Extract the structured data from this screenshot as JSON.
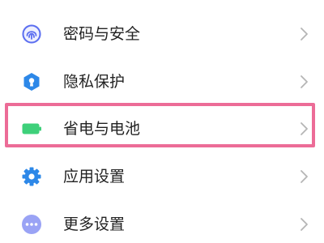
{
  "settings_list": {
    "items": [
      {
        "id": "password-security",
        "label": "密码与安全",
        "icon": "fingerprint-icon",
        "icon_color": "#5b6ef0"
      },
      {
        "id": "privacy",
        "label": "隐私保护",
        "icon": "privacy-shield-icon",
        "icon_color": "#2d88e8"
      },
      {
        "id": "battery",
        "label": "省电与电池",
        "icon": "battery-icon",
        "icon_color": "#3ed07a"
      },
      {
        "id": "app-settings",
        "label": "应用设置",
        "icon": "gear-icon",
        "icon_color": "#2d88e8"
      },
      {
        "id": "more-settings",
        "label": "更多设置",
        "icon": "more-dots-icon",
        "icon_color": "#9aa3f5"
      }
    ],
    "highlighted_item": "battery",
    "highlight_color": "#ec6c97",
    "chevron_color": "#b5b5b5"
  }
}
